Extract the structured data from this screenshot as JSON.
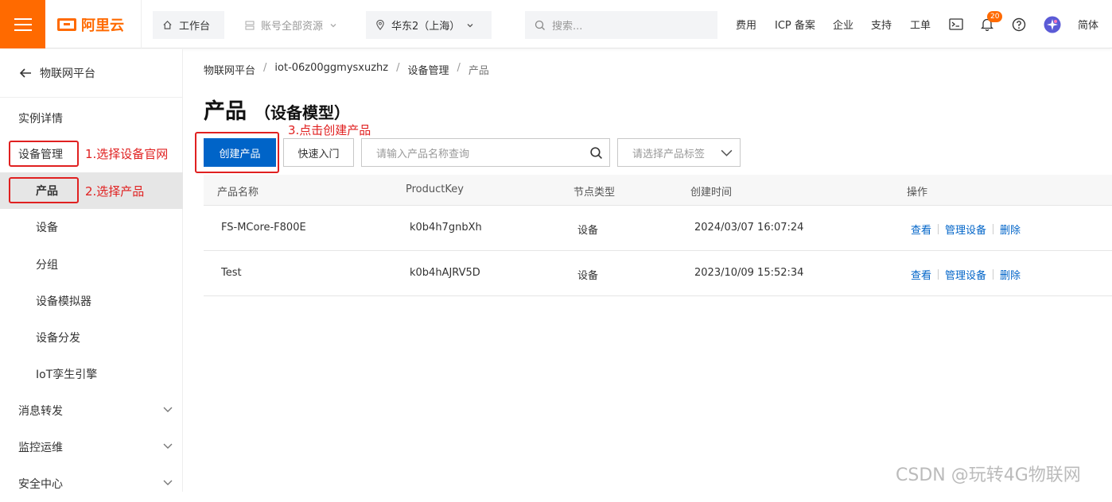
{
  "brand": {
    "name": "阿里云",
    "accent": "#ff6a00"
  },
  "topbar": {
    "workbench": "工作台",
    "resources": "账号全部资源",
    "region": "华东2（上海）",
    "search_placeholder": "搜索...",
    "links": [
      "费用",
      "ICP 备案",
      "企业",
      "支持",
      "工单"
    ],
    "notification_count": "20",
    "language": "简体"
  },
  "sidebar": {
    "back_label": "物联网平台",
    "items": [
      {
        "label": "实例详情"
      },
      {
        "label": "设备管理"
      },
      {
        "label": "产品"
      },
      {
        "label": "设备"
      },
      {
        "label": "分组"
      },
      {
        "label": "设备模拟器"
      },
      {
        "label": "设备分发"
      },
      {
        "label": "IoT孪生引擎"
      },
      {
        "label": "消息转发"
      },
      {
        "label": "监控运维"
      },
      {
        "label": "安全中心"
      }
    ]
  },
  "breadcrumb": [
    "物联网平台",
    "iot-06z00ggmysxuzhz",
    "设备管理",
    "产品"
  ],
  "page": {
    "title": "产品",
    "subtitle": "（设备模型）",
    "create_button": "创建产品",
    "quick_start_button": "快速入门",
    "search_placeholder": "请输入产品名称查询",
    "tag_placeholder": "请选择产品标签"
  },
  "table": {
    "headers": [
      "产品名称",
      "ProductKey",
      "节点类型",
      "创建时间",
      "操作"
    ],
    "rows": [
      {
        "name": "FS-MCore-F800E",
        "key": "k0b4h7gnbXh",
        "node": "设备",
        "created": "2024/03/07 16:07:24"
      },
      {
        "name": "Test",
        "key": "k0b4hAJRV5D",
        "node": "设备",
        "created": "2023/10/09 15:52:34"
      }
    ],
    "actions": [
      "查看",
      "管理设备",
      "删除"
    ]
  },
  "annotations": {
    "step1": "1.选择设备官网",
    "step2": "2.选择产品",
    "step3": "3.点击创建产品"
  },
  "watermark": "CSDN @玩转4G物联网"
}
